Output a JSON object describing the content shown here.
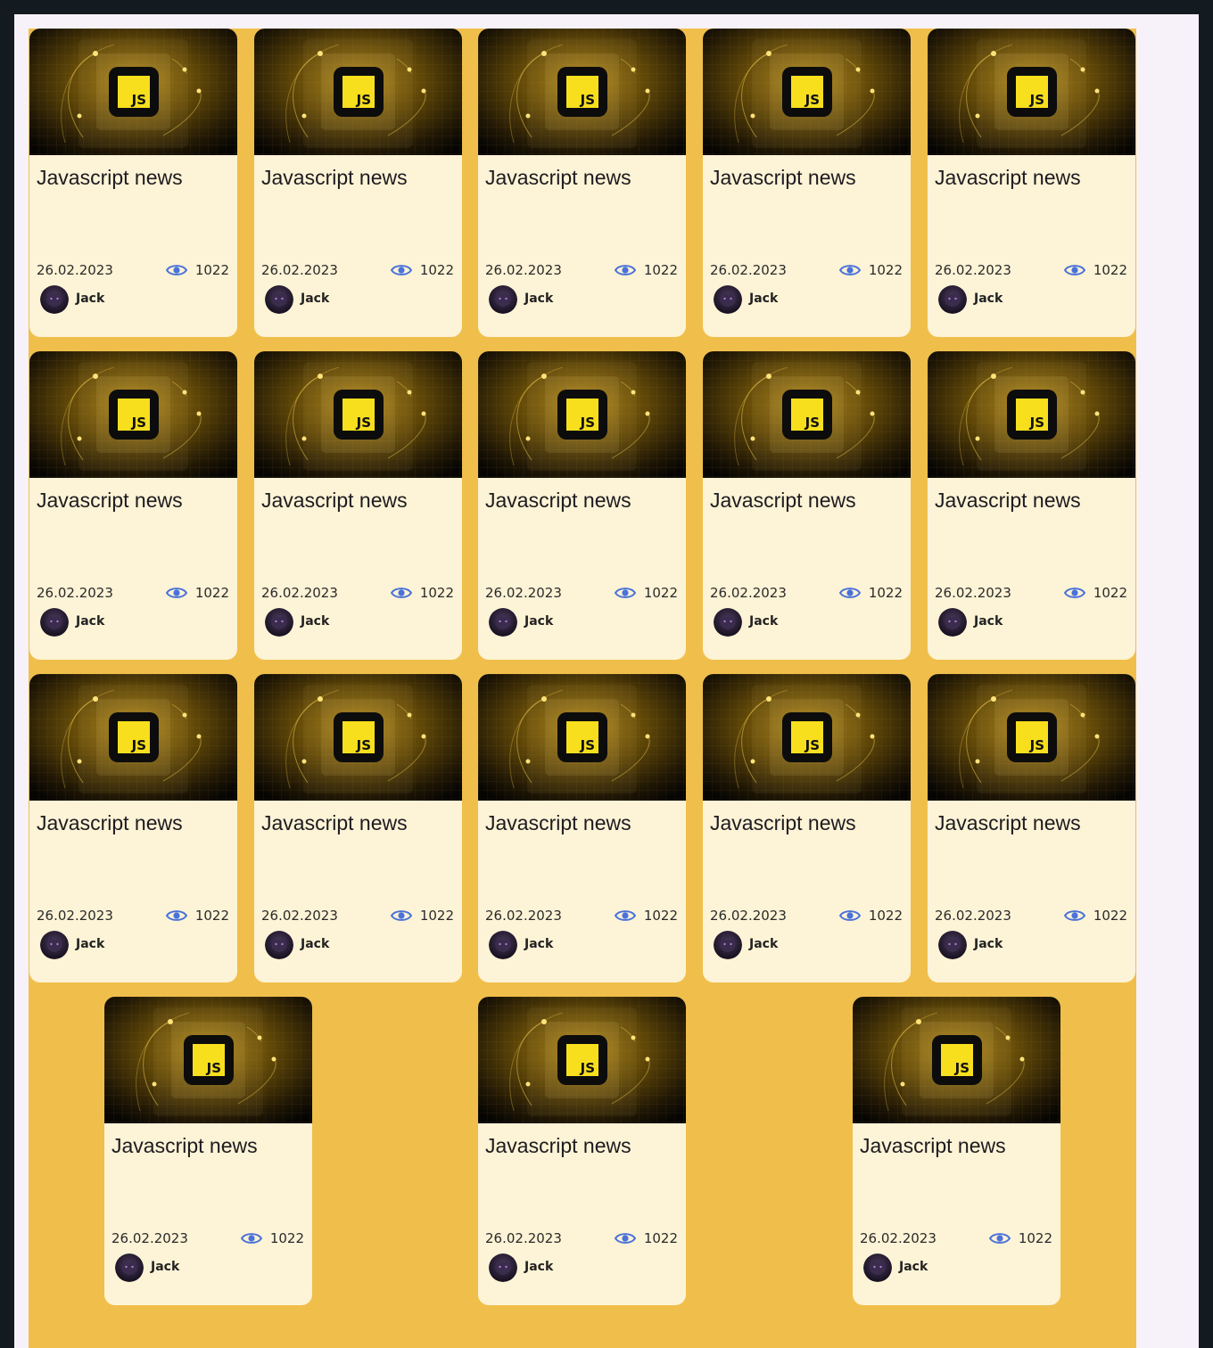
{
  "cards": [
    {
      "title": "Javascript news",
      "date": "26.02.2023",
      "views": "1022",
      "author": "Jack",
      "thumb_icon": "js-logo-icon",
      "avatar_icon": "user-avatar-icon"
    },
    {
      "title": "Javascript news",
      "date": "26.02.2023",
      "views": "1022",
      "author": "Jack",
      "thumb_icon": "js-logo-icon",
      "avatar_icon": "user-avatar-icon"
    },
    {
      "title": "Javascript news",
      "date": "26.02.2023",
      "views": "1022",
      "author": "Jack",
      "thumb_icon": "js-logo-icon",
      "avatar_icon": "user-avatar-icon"
    },
    {
      "title": "Javascript news",
      "date": "26.02.2023",
      "views": "1022",
      "author": "Jack",
      "thumb_icon": "js-logo-icon",
      "avatar_icon": "user-avatar-icon"
    },
    {
      "title": "Javascript news",
      "date": "26.02.2023",
      "views": "1022",
      "author": "Jack",
      "thumb_icon": "js-logo-icon",
      "avatar_icon": "user-avatar-icon"
    },
    {
      "title": "Javascript news",
      "date": "26.02.2023",
      "views": "1022",
      "author": "Jack",
      "thumb_icon": "js-logo-icon",
      "avatar_icon": "user-avatar-icon"
    },
    {
      "title": "Javascript news",
      "date": "26.02.2023",
      "views": "1022",
      "author": "Jack",
      "thumb_icon": "js-logo-icon",
      "avatar_icon": "user-avatar-icon"
    },
    {
      "title": "Javascript news",
      "date": "26.02.2023",
      "views": "1022",
      "author": "Jack",
      "thumb_icon": "js-logo-icon",
      "avatar_icon": "user-avatar-icon"
    },
    {
      "title": "Javascript news",
      "date": "26.02.2023",
      "views": "1022",
      "author": "Jack",
      "thumb_icon": "js-logo-icon",
      "avatar_icon": "user-avatar-icon"
    },
    {
      "title": "Javascript news",
      "date": "26.02.2023",
      "views": "1022",
      "author": "Jack",
      "thumb_icon": "js-logo-icon",
      "avatar_icon": "user-avatar-icon"
    },
    {
      "title": "Javascript news",
      "date": "26.02.2023",
      "views": "1022",
      "author": "Jack",
      "thumb_icon": "js-logo-icon",
      "avatar_icon": "user-avatar-icon"
    },
    {
      "title": "Javascript news",
      "date": "26.02.2023",
      "views": "1022",
      "author": "Jack",
      "thumb_icon": "js-logo-icon",
      "avatar_icon": "user-avatar-icon"
    },
    {
      "title": "Javascript news",
      "date": "26.02.2023",
      "views": "1022",
      "author": "Jack",
      "thumb_icon": "js-logo-icon",
      "avatar_icon": "user-avatar-icon"
    },
    {
      "title": "Javascript news",
      "date": "26.02.2023",
      "views": "1022",
      "author": "Jack",
      "thumb_icon": "js-logo-icon",
      "avatar_icon": "user-avatar-icon"
    },
    {
      "title": "Javascript news",
      "date": "26.02.2023",
      "views": "1022",
      "author": "Jack",
      "thumb_icon": "js-logo-icon",
      "avatar_icon": "user-avatar-icon"
    },
    {
      "title": "Javascript news",
      "date": "26.02.2023",
      "views": "1022",
      "author": "Jack",
      "thumb_icon": "js-logo-icon",
      "avatar_icon": "user-avatar-icon"
    },
    {
      "title": "Javascript news",
      "date": "26.02.2023",
      "views": "1022",
      "author": "Jack",
      "thumb_icon": "js-logo-icon",
      "avatar_icon": "user-avatar-icon"
    },
    {
      "title": "Javascript news",
      "date": "26.02.2023",
      "views": "1022",
      "author": "Jack",
      "thumb_icon": "js-logo-icon",
      "avatar_icon": "user-avatar-icon"
    }
  ],
  "js_badge_text": "JS",
  "colors": {
    "page_background": "#131a20",
    "content_background": "#f7f2fa",
    "grid_background": "#f0bf4b",
    "card_background": "#fdf3d6",
    "eye_icon": "#4a72d9",
    "js_yellow": "#f7df1e"
  }
}
